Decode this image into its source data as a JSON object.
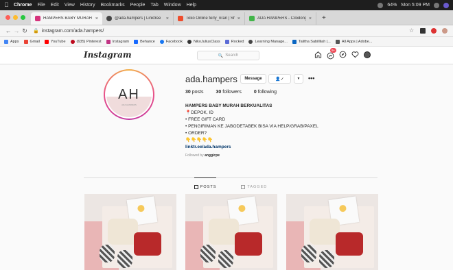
{
  "menubar": {
    "items": [
      "Chrome",
      "File",
      "Edit",
      "View",
      "History",
      "Bookmarks",
      "People",
      "Tab",
      "Window",
      "Help"
    ],
    "battery": "64%",
    "clock": "Mon 5:09 PM"
  },
  "tabs": [
    {
      "title": "HAMPERS BABY MURAH BERK",
      "color": "#d6337c"
    },
    {
      "title": "@ada.hampers | Linktree",
      "color": "#444444"
    },
    {
      "title": "Toko Online ferly_riran | Shope",
      "color": "#ee4d2d"
    },
    {
      "title": "ADA HAMPERS - Cilodong, Kot",
      "color": "#42b549"
    }
  ],
  "address": {
    "url": "instagram.com/ada.hampers/"
  },
  "bookmarks": [
    {
      "label": "Apps",
      "color": "#4285f4"
    },
    {
      "label": "Gmail",
      "color": "#ea4335"
    },
    {
      "label": "YouTube",
      "color": "#ff0000"
    },
    {
      "label": "(635) Pinterest",
      "color": "#bd081c"
    },
    {
      "label": "Instagram",
      "color": "#c13584"
    },
    {
      "label": "Behance",
      "color": "#1769ff"
    },
    {
      "label": "Facebook",
      "color": "#1877f2"
    },
    {
      "label": "NikoJuliusClass",
      "color": "#333333"
    },
    {
      "label": "Rocked",
      "color": "#5b6bd6"
    },
    {
      "label": "Learning Manage...",
      "color": "#444444"
    },
    {
      "label": "Talitha Sabillilah |...",
      "color": "#0a66c2"
    },
    {
      "label": "All Apps | Adobe...",
      "color": "#555555"
    }
  ],
  "ig": {
    "logo": "Instagram",
    "search_placeholder": "Search",
    "notification_count": "9+"
  },
  "profile": {
    "avatar_initials": "AH",
    "avatar_sub": "ADA HAMPERS",
    "username": "ada.hampers",
    "message_label": "Message",
    "follow_label": "✓",
    "posts_count": "30",
    "posts_label": "posts",
    "followers_count": "30",
    "followers_label": "followers",
    "following_count": "0",
    "following_label": "following",
    "bio_name": "HAMPERS BABY MURAH BERKUALITAS",
    "bio_lines": [
      "📍DEPOK, ID",
      "• FREE GIFT CARD",
      "• PENGIRIMAN KE JABODETABEK BISA VIA HELP/GRAB/PAXEL",
      "• ORDER?"
    ],
    "bio_emojis": "👇👇👇👇👇",
    "link": "linktr.ee/ada.hampers",
    "followed_by_prefix": "Followed by",
    "followed_by_user": "anggicpe"
  },
  "profile_tabs": [
    {
      "label": "POSTS",
      "active": true
    },
    {
      "label": "TAGGED",
      "active": false
    }
  ],
  "colors": {
    "accent_blue": "#003569",
    "notification_red": "#ed4956"
  }
}
